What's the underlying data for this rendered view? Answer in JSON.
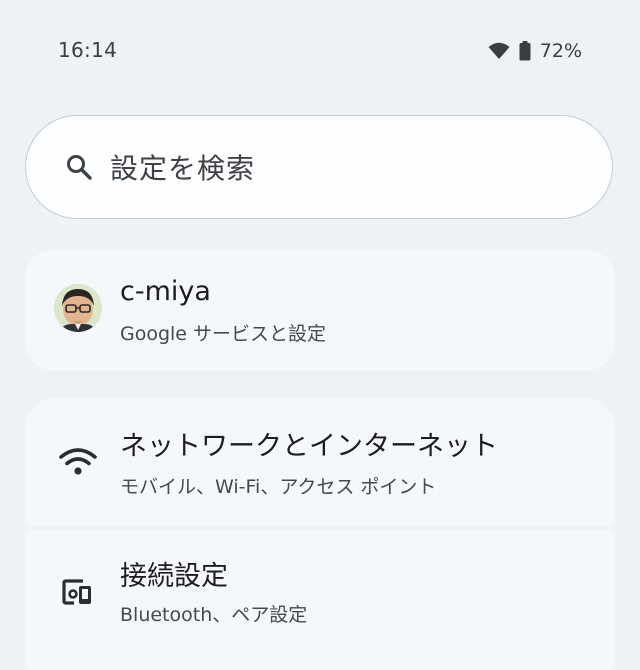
{
  "status_bar": {
    "time": "16:14",
    "battery_percent": "72%",
    "wifi_icon": "wifi-full-icon",
    "battery_icon": "battery-icon"
  },
  "search": {
    "placeholder": "設定を検索",
    "icon": "search-icon"
  },
  "account": {
    "name": "c-miya",
    "subtitle": "Google サービスと設定",
    "avatar_icon": "avatar-cartoon"
  },
  "settings_items": [
    {
      "title": "ネットワークとインターネット",
      "subtitle": "モバイル、Wi-Fi、アクセス ポイント",
      "icon": "wifi-icon"
    },
    {
      "title": "接続設定",
      "subtitle": "Bluetooth、ペア設定",
      "icon": "connected-devices-icon"
    }
  ],
  "colors": {
    "background": "#eef2f6",
    "card": "#f5f8fb",
    "search_bg": "#fdfeff",
    "text_primary": "#1b1c1f",
    "text_secondary": "#45484d"
  }
}
